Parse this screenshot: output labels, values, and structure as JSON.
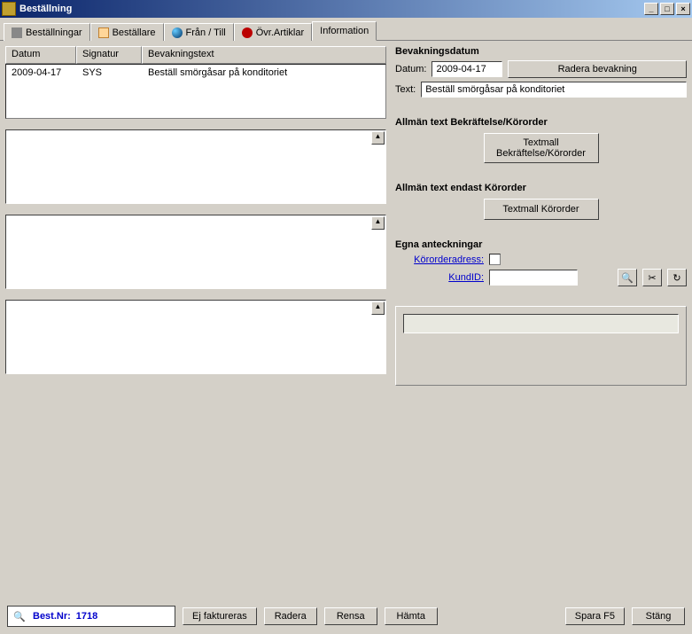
{
  "window": {
    "title": "Beställning",
    "min": "_",
    "max": "□",
    "close": "×"
  },
  "tabs": [
    {
      "label": "Beställningar"
    },
    {
      "label": "Beställare"
    },
    {
      "label": "Från / Till"
    },
    {
      "label": "Övr.Artiklar"
    },
    {
      "label": "Information"
    }
  ],
  "grid": {
    "headers": {
      "datum": "Datum",
      "signatur": "Signatur",
      "bevtext": "Bevakningstext"
    },
    "row1": {
      "datum": "2009-04-17",
      "signatur": "SYS",
      "bevtext": "Beställ smörgåsar på konditoriet"
    }
  },
  "right": {
    "bev_header": "Bevakningsdatum",
    "datum_label": "Datum:",
    "datum_value": "2009-04-17",
    "radera_bev": "Radera bevakning",
    "text_label": "Text:",
    "text_value": "Beställ smörgåsar på konditoriet",
    "allman_bk": "Allmän text Bekräftelse/Körorder",
    "textmall_bk": "Textmall Bekräftelse/Körorder",
    "allman_ko": "Allmän text endast Körorder",
    "textmall_ko": "Textmall Körorder",
    "egna": "Egna anteckningar",
    "kororderadress": "Körorderadress:",
    "kundid": "KundID:"
  },
  "icons": {
    "binoculars": "🔍",
    "scissors": "✂",
    "refresh": "↻"
  },
  "bottom": {
    "order_prefix": "Best.Nr:",
    "order_no": "1718",
    "ejfakt": "Ej faktureras",
    "radera": "Radera",
    "rensa": "Rensa",
    "hamta": "Hämta",
    "spara": "Spara F5",
    "stang": "Stäng"
  }
}
